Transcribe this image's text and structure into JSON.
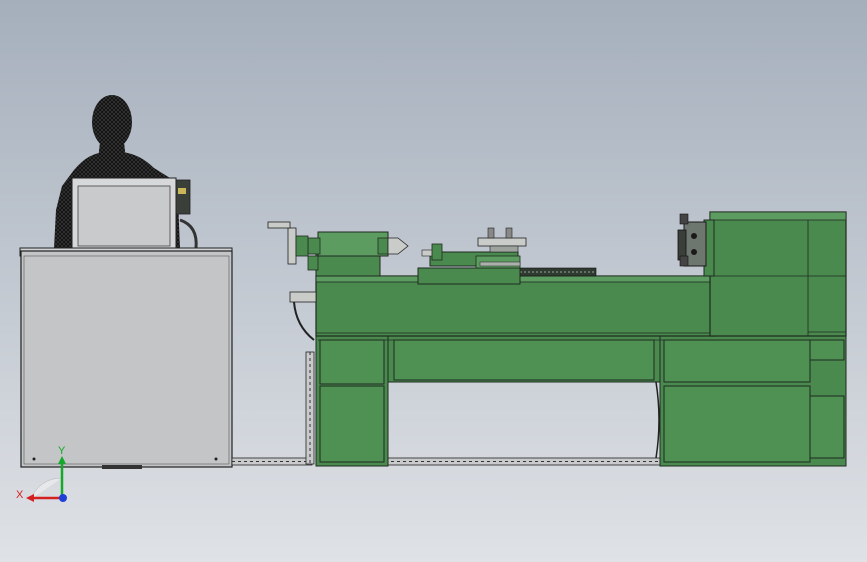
{
  "view": {
    "background_top": "#a7b1bd",
    "background_bottom": "#dde1e6",
    "machine_green": "#4b8a4f",
    "machine_green_light": "#5c9c60",
    "outline": "#1e2a1f",
    "cabinet_gray": "#c2c4c6",
    "person_fill": "#1a1a1a"
  },
  "triad": {
    "x_label": "X",
    "y_label": "Y",
    "x_color": "#d42020",
    "y_color": "#16a82b",
    "z_color": "#1f3fd6"
  }
}
